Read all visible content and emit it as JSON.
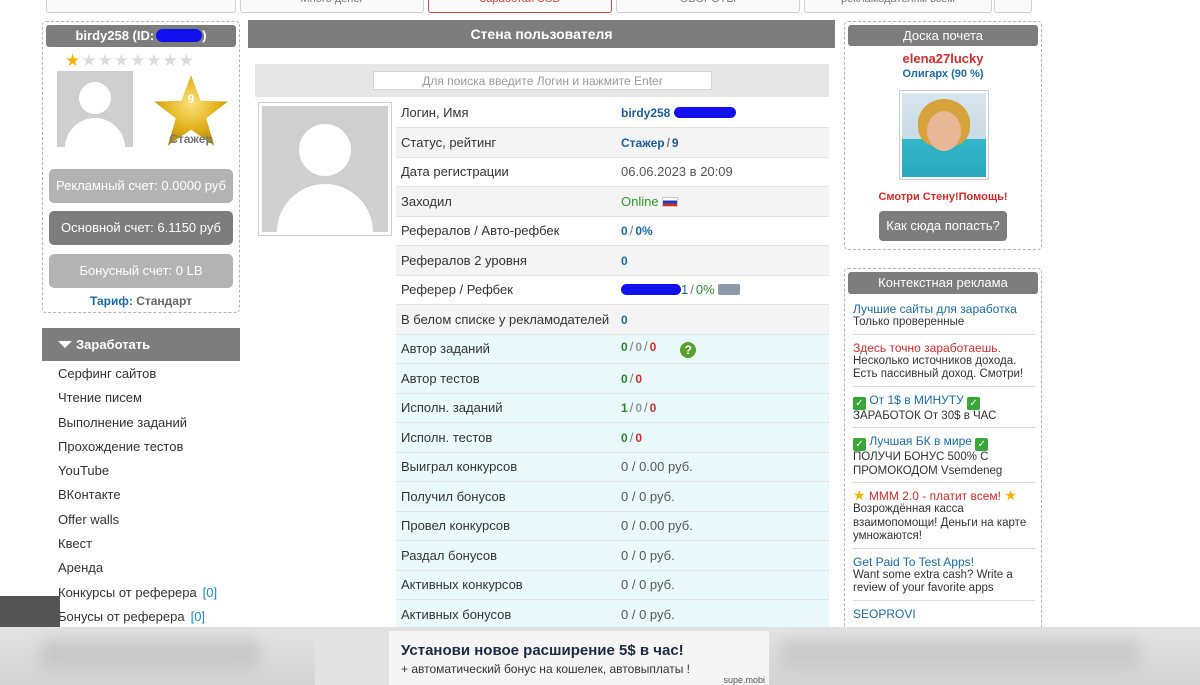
{
  "top_tabs": [
    "Много денег",
    "Заработай USD",
    "ОБОРОТЫ",
    "рекламодателям всем"
  ],
  "user": {
    "title": "birdy258 (ID:",
    "title_tail": ")",
    "level_number": "9",
    "rank": "Стажер",
    "ad_account": "Рекламный счет: 0.0000 руб",
    "main_account": "Основной счет: 6.1150 руб",
    "bonus_account": "Бонусный счет: 0 LB",
    "tariff_label": "Тариф:",
    "tariff_value": "Стандарт"
  },
  "earn_menu": {
    "header": "Заработать",
    "items": [
      {
        "label": "Серфинг сайтов"
      },
      {
        "label": "Чтение писем"
      },
      {
        "label": "Выполнение заданий"
      },
      {
        "label": "Прохождение тестов"
      },
      {
        "label": "YouTube"
      },
      {
        "label": "ВКонтакте"
      },
      {
        "label": "Offer walls"
      },
      {
        "label": "Квест"
      },
      {
        "label": "Аренда"
      },
      {
        "label": "Конкурсы от реферера",
        "count": "[0]"
      },
      {
        "label": "Бонусы от реферера",
        "count": "[0]"
      }
    ]
  },
  "wall": {
    "title": "Стена пользователя",
    "search_placeholder": "Для поиска введите Логин и нажмите Enter",
    "rows": {
      "login": {
        "label": "Логин, Имя",
        "value": "birdy258"
      },
      "status": {
        "label": "Статус, рейтинг",
        "rank": "Стажер",
        "rating": "9"
      },
      "reg": {
        "label": "Дата регистрации",
        "value": "06.06.2023 в 20:09"
      },
      "visit": {
        "label": "Заходил",
        "value": "Online"
      },
      "refs": {
        "label": "Рефералов / Авто-рефбек",
        "count": "0",
        "percent": "0%"
      },
      "refs2": {
        "label": "Рефералов 2 уровня",
        "count": "0"
      },
      "referer": {
        "label": "Реферер / Рефбек",
        "tail": "1",
        "percent": "0%"
      },
      "whitelist": {
        "label": "В белом списке у рекламодателей",
        "count": "0"
      },
      "task_author": {
        "label": "Автор заданий",
        "a": "0",
        "b": "0",
        "c": "0"
      },
      "test_author": {
        "label": "Автор тестов",
        "a": "0",
        "b": "0"
      },
      "task_exec": {
        "label": "Исполн. заданий",
        "a": "1",
        "b": "0",
        "c": "0"
      },
      "test_exec": {
        "label": "Исполн. тестов",
        "a": "0",
        "b": "0"
      },
      "won": {
        "label": "Выиграл конкурсов",
        "value": "0 / 0.00 руб."
      },
      "got_bonus": {
        "label": "Получил бонусов",
        "value": "0 / 0 руб."
      },
      "held": {
        "label": "Провел конкурсов",
        "value": "0 / 0.00 руб."
      },
      "gave": {
        "label": "Раздал бонусов",
        "value": "0 / 0 руб."
      },
      "active_contests": {
        "label": "Активных конкурсов",
        "value": "0 / 0 руб."
      },
      "active_bonuses": {
        "label": "Активных бонусов",
        "value": "0 / 0 руб."
      }
    }
  },
  "board": {
    "title": "Доска почета",
    "user": "elena27lucky",
    "status": "Олигарх (90 %)",
    "link": "Смотри Стену!Помощь!",
    "button": "Как сюда попасть?"
  },
  "context_ads": {
    "title": "Контекстная реклама",
    "ad1": {
      "title": "Лучшие сайты для заработка",
      "desc": "Только проверенные"
    },
    "ad2": {
      "title": "Здесь точно заработаешь.",
      "desc": "Несколько источников дохода. Есть пассивный доход. Смотри!"
    },
    "ad3": {
      "title": "От 1$ в МИНУТУ",
      "desc": "ЗАРАБОТОК От 30$ в ЧАС"
    },
    "ad4": {
      "title": "Лучшая БК в мире",
      "desc": "ПОЛУЧИ БОНУС 500% С ПРОМОКОДОМ Vsemdeneg"
    },
    "ad5": {
      "title": "МММ 2.0 - платит всем!",
      "desc": "Возрождённая касса взаимопомощи! Деньги на карте умножаются!"
    },
    "ad6": {
      "title": "Get Paid To Test Apps!",
      "desc": "Want some extra cash? Write a review of your favorite apps"
    },
    "ad7": {
      "title": "SEOPROVI"
    }
  },
  "banner": {
    "title": "Установи новое расширение 5$ в час!",
    "subtitle": "+ автоматический бонус на кошелек, автовыплаты !",
    "source": "supe.mobi"
  },
  "colors": {
    "header_grey": "#7d7d7d",
    "link_blue": "#1a6aa6",
    "accent_red": "#d62b2b",
    "online_green": "#2b9a2b"
  }
}
